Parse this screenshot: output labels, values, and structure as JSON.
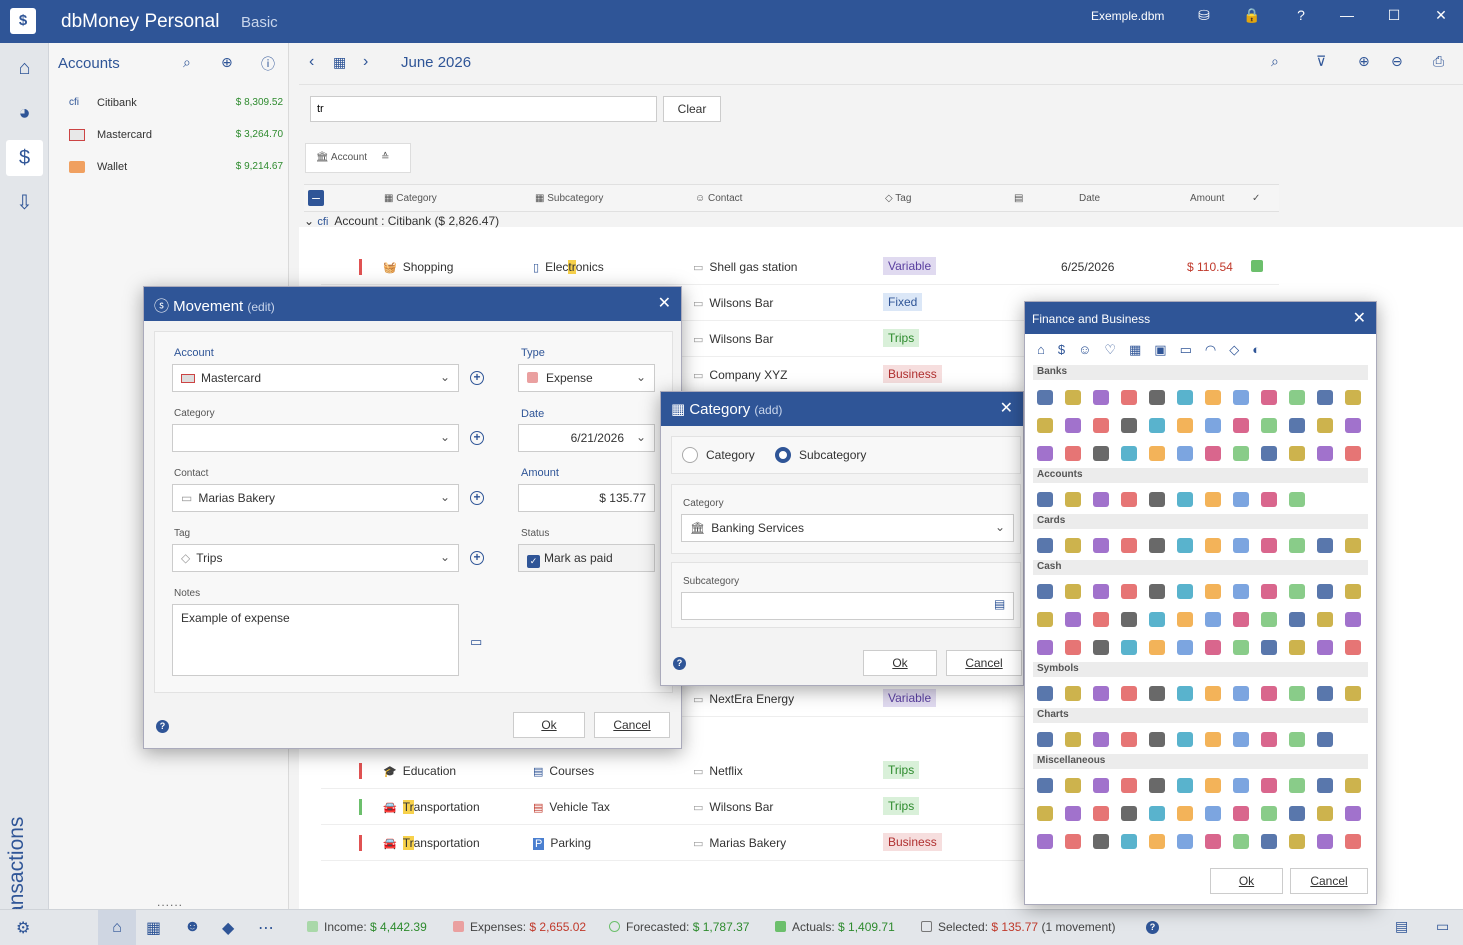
{
  "app": {
    "title": "dbMoney Personal",
    "edition": "Basic",
    "file": "Exemple.dbm"
  },
  "accounts": {
    "title": "Accounts",
    "items": [
      {
        "name": "Citibank",
        "balance": "$ 8,309.52"
      },
      {
        "name": "Mastercard",
        "balance": "$ 3,264.70"
      },
      {
        "name": "Wallet",
        "balance": "$ 9,214.67"
      }
    ],
    "more": "......"
  },
  "rail": {
    "vertical_label": "Transactions"
  },
  "nav": {
    "month": "June 2026"
  },
  "search": {
    "value": "tr",
    "clear_label": "Clear"
  },
  "group_chip": {
    "label": "Account"
  },
  "columns": {
    "category": "Category",
    "subcategory": "Subcategory",
    "contact": "Contact",
    "tag": "Tag",
    "date": "Date",
    "amount": "Amount"
  },
  "group_row": {
    "label": "Account : Citibank ($ 2,826.47)"
  },
  "rows": [
    {
      "cat_pre": "",
      "cat_hl": "",
      "cat_post": "Shopping",
      "sub_pre": "Elec",
      "sub_hl": "tr",
      "sub_post": "onics",
      "contact": "Shell gas station",
      "tag": "Variable",
      "date": "6/25/2026",
      "amount": "$ 110.54"
    },
    {
      "cat_pre": "",
      "cat_hl": "",
      "cat_post": "",
      "sub_pre": "",
      "sub_hl": "",
      "sub_post": "",
      "contact": "Wilsons Bar",
      "tag": "Fixed",
      "date": "",
      "amount": ""
    },
    {
      "cat_pre": "",
      "cat_hl": "",
      "cat_post": "",
      "sub_pre": "",
      "sub_hl": "",
      "sub_post": "",
      "contact": "Wilsons Bar",
      "tag": "Trips",
      "date": "",
      "amount": ""
    },
    {
      "cat_pre": "",
      "cat_hl": "",
      "cat_post": "",
      "sub_pre": "",
      "sub_hl": "",
      "sub_post": "",
      "contact": "Company XYZ",
      "tag": "Business",
      "date": "",
      "amount": ""
    },
    {
      "cat_pre": "",
      "cat_hl": "",
      "cat_post": "",
      "sub_pre": "",
      "sub_hl": "",
      "sub_post": "",
      "contact": "NextEra Energy",
      "tag": "Variable",
      "date": "",
      "amount": ""
    },
    {
      "cat_pre": "",
      "cat_hl": "",
      "cat_post": "Education",
      "sub_pre": "",
      "sub_hl": "",
      "sub_post": "Courses",
      "contact": "Netflix",
      "tag": "Trips",
      "date": "",
      "amount": ""
    },
    {
      "cat_pre": "",
      "cat_hl": "Tr",
      "cat_post": "ansportation",
      "sub_pre": "",
      "sub_hl": "",
      "sub_post": "Vehicle Tax",
      "contact": "Wilsons Bar",
      "tag": "Trips",
      "date": "",
      "amount": ""
    },
    {
      "cat_pre": "",
      "cat_hl": "Tr",
      "cat_post": "ansportation",
      "sub_pre": "",
      "sub_hl": "",
      "sub_post": "Parking",
      "contact": "Marias Bakery",
      "tag": "Business",
      "date": "",
      "amount": ""
    }
  ],
  "status": {
    "income_label": "Income:",
    "income": "$ 4,442.39",
    "expenses_label": "Expenses:",
    "expenses": "$ 2,655.02",
    "forecasted_label": "Forecasted:",
    "forecasted": "$ 1,787.37",
    "actuals_label": "Actuals:",
    "actuals": "$ 1,409.71",
    "selected_label": "Selected:",
    "selected": "$ 135.77",
    "selected_count": "(1 movement)"
  },
  "movement": {
    "title": "Movement",
    "mode": "(edit)",
    "account_label": "Account",
    "account": "Mastercard",
    "type_label": "Type",
    "type": "Expense",
    "category_label": "Category",
    "category": "",
    "date_label": "Date",
    "date": "6/21/2026",
    "contact_label": "Contact",
    "contact": "Marias Bakery",
    "amount_label": "Amount",
    "amount": "$ 135.77",
    "tag_label": "Tag",
    "tag": "Trips",
    "status_label": "Status",
    "paid_label": "Mark as paid",
    "notes_label": "Notes",
    "notes": "Example of expense",
    "ok": "Ok",
    "cancel": "Cancel"
  },
  "category_dlg": {
    "title": "Category",
    "mode": "(add)",
    "opt_category": "Category",
    "opt_subcategory": "Subcategory",
    "category_label": "Category",
    "category": "Banking Services",
    "subcategory_label": "Subcategory",
    "subcategory": "",
    "ok": "Ok",
    "cancel": "Cancel"
  },
  "finance": {
    "title": "Finance and Business",
    "groups": [
      "Banks",
      "Accounts",
      "Cards",
      "Cash",
      "Symbols",
      "Charts",
      "Miscellaneous"
    ],
    "ok": "Ok",
    "cancel": "Cancel"
  }
}
